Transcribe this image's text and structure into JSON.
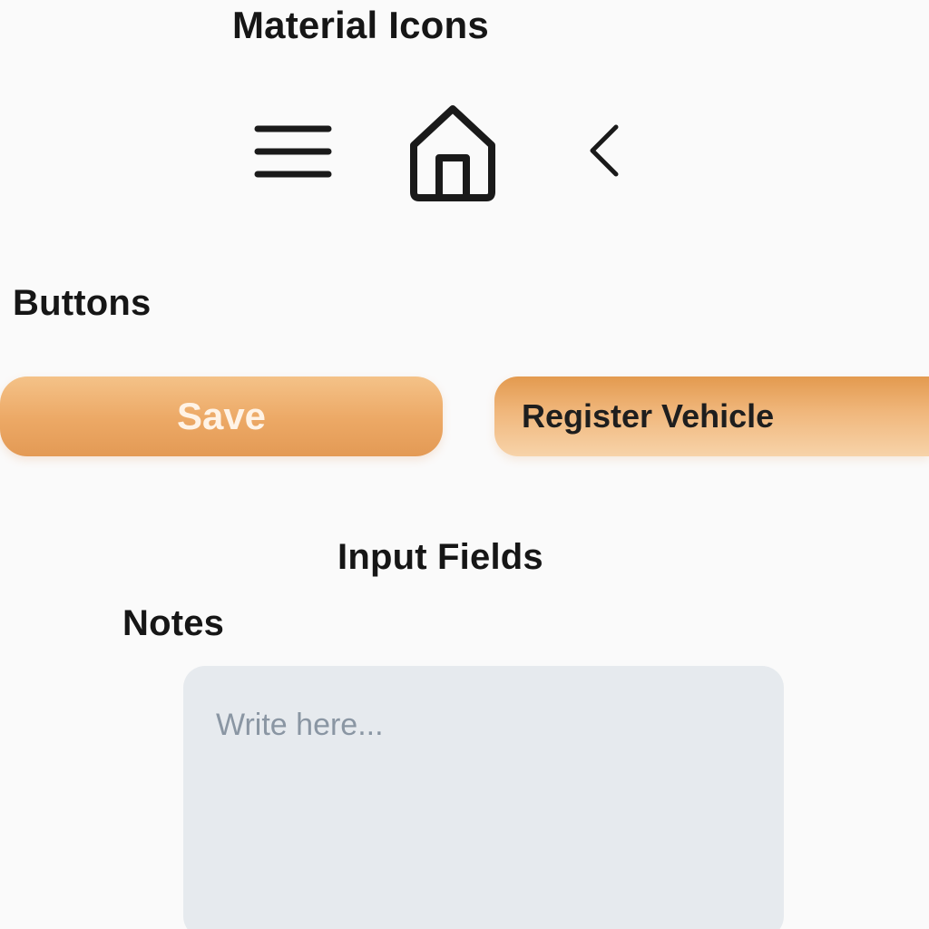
{
  "sections": {
    "icons_title": "Material Icons",
    "buttons_title": "Buttons",
    "inputs_title": "Input Fields"
  },
  "icons": [
    {
      "name": "menu-icon"
    },
    {
      "name": "home-icon"
    },
    {
      "name": "back-chevron-icon"
    }
  ],
  "buttons": {
    "save_label": "Save",
    "register_label": "Register Vehicle"
  },
  "notes": {
    "label": "Notes",
    "value": "",
    "placeholder": "Write here..."
  },
  "colors": {
    "accent": "#eca865",
    "accent_dark": "#e39a4f",
    "textarea_bg": "#e6eaee",
    "placeholder": "#8a96a3"
  }
}
